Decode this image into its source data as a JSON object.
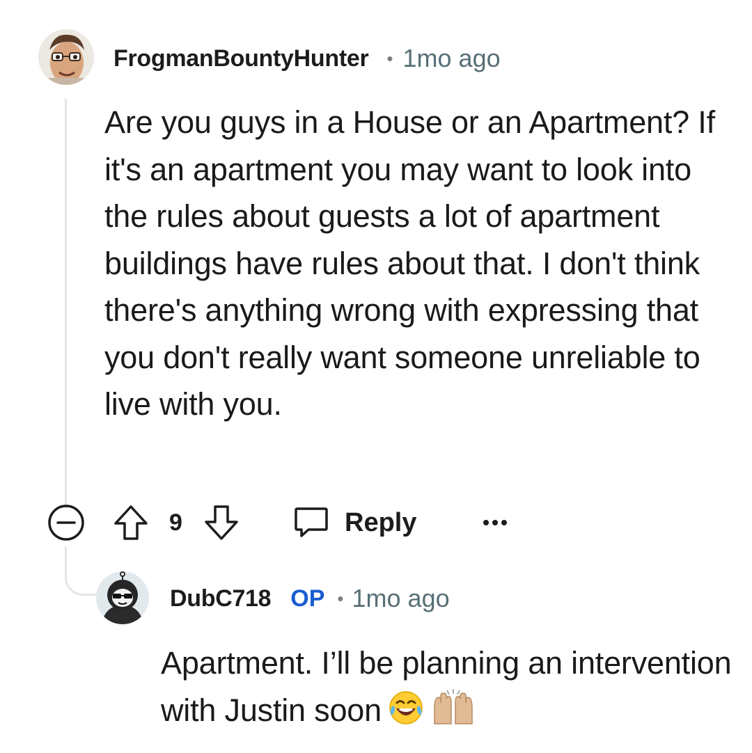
{
  "comment": {
    "author": "FrogmanBountyHunter",
    "separator": "•",
    "time": "1mo ago",
    "body": "Are you guys in a House or an Apartment? If it's an apartment you may want to look into the rules about guests a lot of apartment buildings have rules about that. I don't think there's anything wrong with expressing that you don't really want someone unreliable to live with you.",
    "actions": {
      "vote_count": "9",
      "reply_label": "Reply",
      "more_label": "•••"
    }
  },
  "reply": {
    "author": "DubC718",
    "badge": "OP",
    "separator": "•",
    "time": "1mo ago",
    "body": "Apartment. I’ll be planning an intervention with Justin soon",
    "emojis": [
      "face-with-tears-of-joy",
      "raising-hands"
    ]
  },
  "icons": {
    "collapse": "minus-circle-icon",
    "upvote": "arrow-up-icon",
    "downvote": "arrow-down-icon",
    "reply": "speech-bubble-icon",
    "more": "ellipsis-icon"
  },
  "colors": {
    "op_badge": "#1a5cd0",
    "timestamp": "#576f76",
    "thread_line": "#e3e5e8"
  }
}
